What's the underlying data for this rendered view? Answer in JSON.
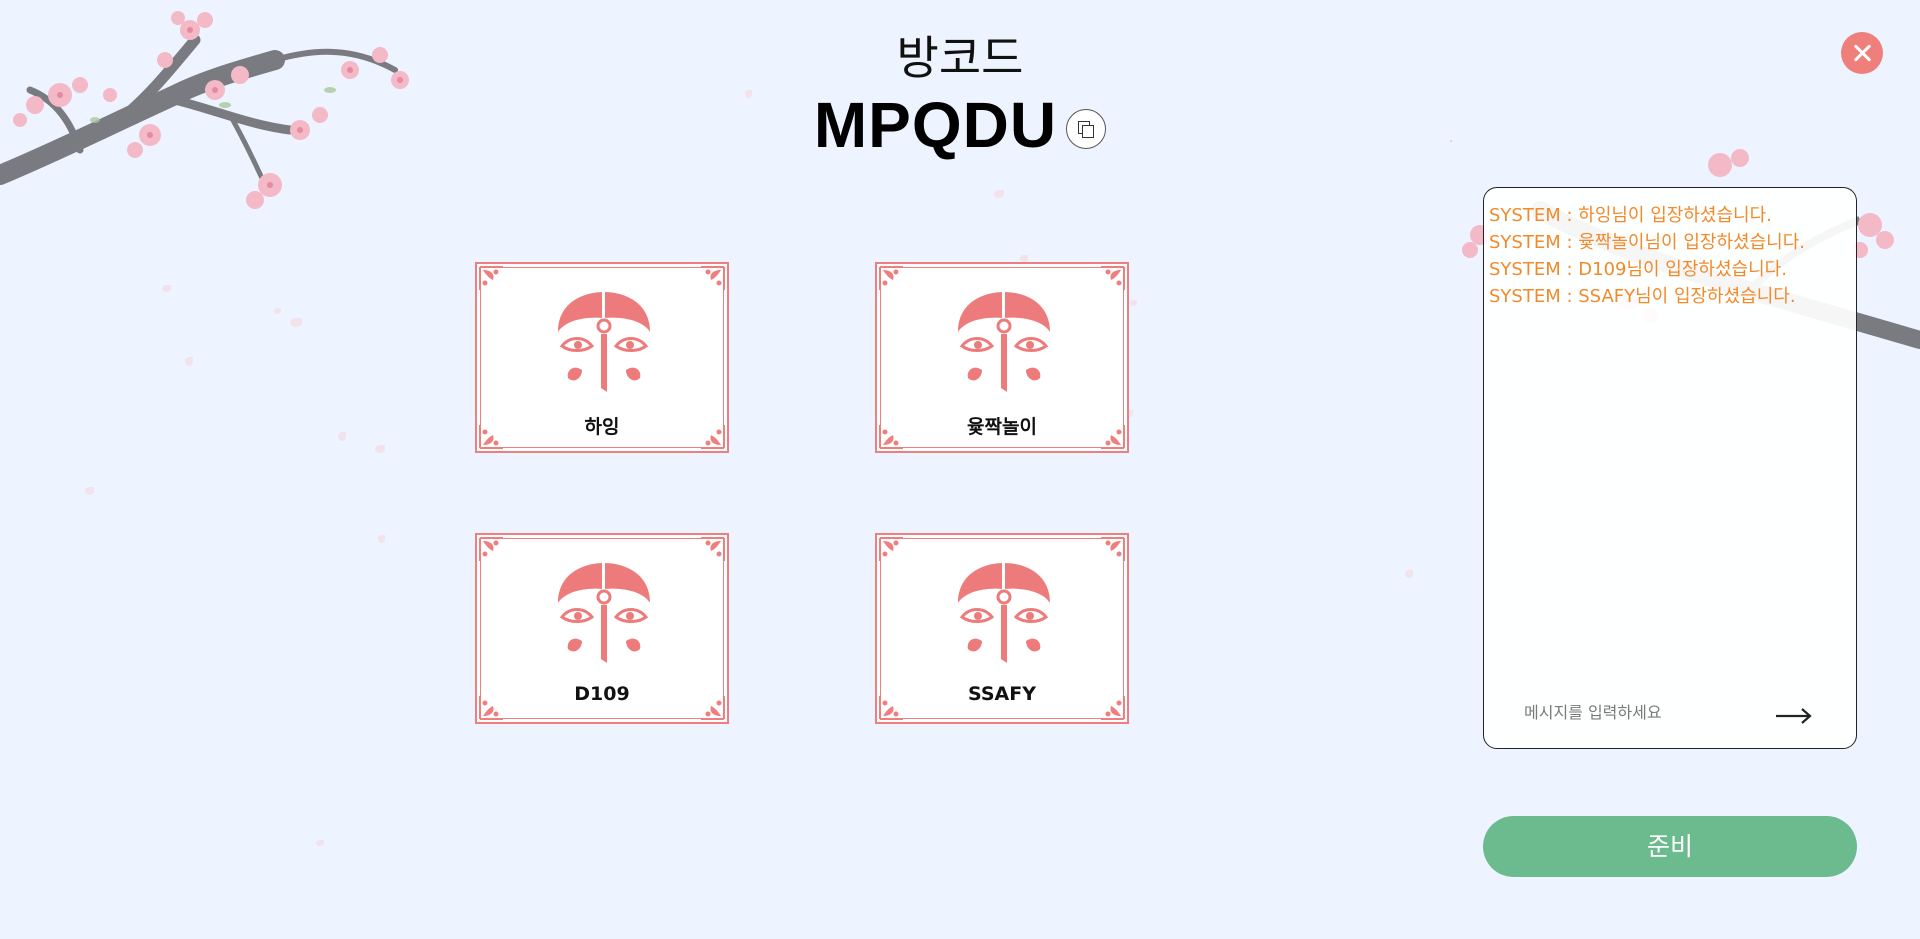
{
  "room": {
    "label": "방코드",
    "code": "MPQDU"
  },
  "players": [
    {
      "name": "하잉"
    },
    {
      "name": "윷짝놀이"
    },
    {
      "name": "D109"
    },
    {
      "name": "SSAFY"
    }
  ],
  "chat": {
    "messages": [
      "SYSTEM : 하잉님이 입장하셨습니다.",
      "SYSTEM : 윷짝놀이님이 입장하셨습니다.",
      "SYSTEM : D109님이 입장하셨습니다.",
      "SYSTEM : SSAFY님이 입장하셨습니다."
    ],
    "input_placeholder": "메시지를 입력하세요"
  },
  "ready_button": "준비",
  "icons": {
    "copy": "copy-icon",
    "close": "close-icon",
    "send": "arrow-right-icon",
    "mask": "hahoe-mask-icon"
  },
  "colors": {
    "background": "#eef4ff",
    "card_border": "#ef7e7e",
    "mask": "#ee7b7b",
    "close_button": "#ef7f7a",
    "system_message": "#f28a2a",
    "ready_button": "#6cbb8e"
  }
}
